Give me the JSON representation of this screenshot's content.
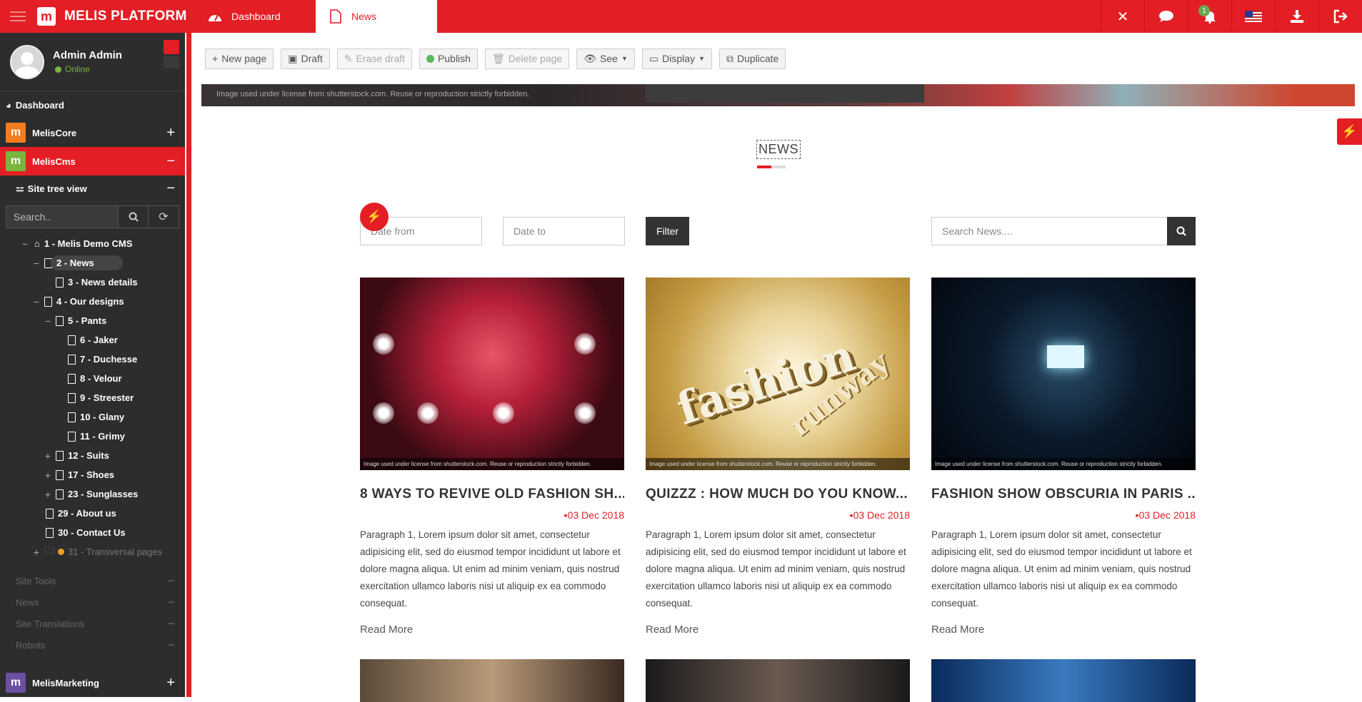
{
  "topbar": {
    "brand": "MELIS PLATFORM",
    "tabs": [
      {
        "label": "Dashboard",
        "icon": "dashboard-icon"
      },
      {
        "label": "News",
        "icon": "page-icon"
      }
    ],
    "notification_count": "1"
  },
  "sidebar": {
    "user_name": "Admin Admin",
    "user_status": "Online",
    "dashboard_label": "Dashboard",
    "modules": [
      {
        "label": "MelisCore",
        "color": "#f47c20",
        "toggle": "+"
      },
      {
        "label": "MelisCms",
        "color": "#79b43c",
        "toggle": "−"
      }
    ],
    "site_tree_label": "Site tree view",
    "search_placeholder": "Search..",
    "tree": [
      {
        "label": "1 - Melis Demo CMS",
        "level": 0
      },
      {
        "label": "2 - News",
        "level": 1
      },
      {
        "label": "3 - News details",
        "level": 2
      },
      {
        "label": "4 - Our designs",
        "level": 1
      },
      {
        "label": "5 - Pants",
        "level": 2
      },
      {
        "label": "6 - Jaker",
        "level": 3
      },
      {
        "label": "7 - Duchesse",
        "level": 3
      },
      {
        "label": "8 - Velour",
        "level": 3
      },
      {
        "label": "9 - Streester",
        "level": 3
      },
      {
        "label": "10 - Glany",
        "level": 3
      },
      {
        "label": "11 - Grimy",
        "level": 3
      },
      {
        "label": "12 - Suits",
        "level": 2
      },
      {
        "label": "17 - Shoes",
        "level": 2
      },
      {
        "label": "23 - Sunglasses",
        "level": 2
      },
      {
        "label": "29 - About us",
        "level": 1
      },
      {
        "label": "30 - Contact Us",
        "level": 1
      },
      {
        "label": "31 - Transversal pages",
        "level": 1
      }
    ],
    "faded_items": [
      "Site Tools",
      "News",
      "Site Translations",
      "Robots"
    ],
    "bottom_module": {
      "label": "MelisMarketing",
      "color": "#6b4fa0"
    }
  },
  "toolbar": {
    "new_page": "New page",
    "draft": "Draft",
    "erase_draft": "Erase draft",
    "publish": "Publish",
    "delete_page": "Delete page",
    "see": "See",
    "display": "Display",
    "duplicate": "Duplicate"
  },
  "content": {
    "banner_caption": "Image used under license from shutterstock.com. Reuse or reproduction strictly forbidden.",
    "section_title": "NEWS",
    "date_from_placeholder": "Date from",
    "date_to_placeholder": "Date to",
    "filter_label": "Filter",
    "search_placeholder": "Search News....",
    "image_caption": "Image used under license from shutterstock.com. Reuse or reproduction strictly forbidden.",
    "cards": [
      {
        "title": "8 WAYS TO REVIVE OLD FASHION SH...",
        "date": "03 Dec 2018",
        "text": "Paragraph 1, Lorem ipsum dolor sit amet, consectetur adipisicing elit, sed do eiusmod tempor incididunt ut labore et dolore magna aliqua. Ut enim ad minim veniam, quis nostrud exercitation ullamco laboris nisi ut aliquip ex ea commodo consequat.",
        "read_more": "Read More"
      },
      {
        "title": "QUIZZZ : HOW MUCH DO YOU KNOW...",
        "date": "03 Dec 2018",
        "text": "Paragraph 1, Lorem ipsum dolor sit amet, consectetur adipisicing elit, sed do eiusmod tempor incididunt ut labore et dolore magna aliqua. Ut enim ad minim veniam, quis nostrud exercitation ullamco laboris nisi ut aliquip ex ea commodo consequat.",
        "read_more": "Read More"
      },
      {
        "title": "FASHION SHOW OBSCURIA IN PARIS ...",
        "date": "03 Dec 2018",
        "text": "Paragraph 1, Lorem ipsum dolor sit amet, consectetur adipisicing elit, sed do eiusmod tempor incididunt ut labore et dolore magna aliqua. Ut enim ad minim veniam, quis nostrud exercitation ullamco laboris nisi ut aliquip ex ea commodo consequat.",
        "read_more": "Read More"
      }
    ],
    "image2_words": {
      "main": "fashion",
      "secondary": "runway"
    }
  },
  "colors": {
    "accent": "#e31e24",
    "sidebar_bg": "#2d2d2d"
  }
}
